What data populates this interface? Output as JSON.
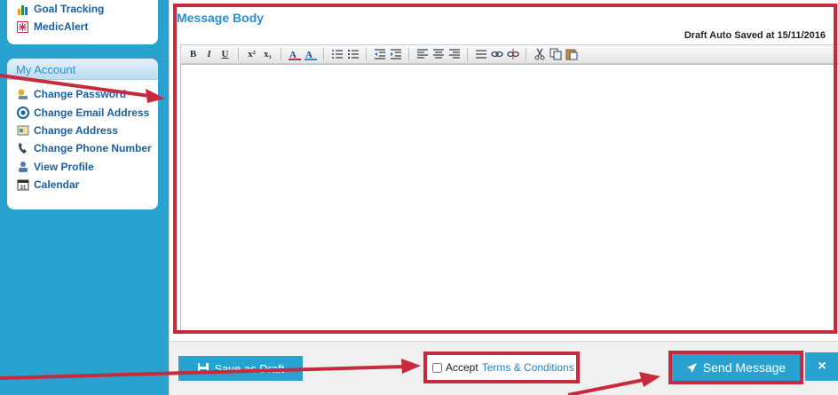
{
  "sidebar": {
    "top_items": [
      {
        "label": "Goal Tracking",
        "icon": "bar-chart-icon"
      },
      {
        "label": "MedicAlert",
        "icon": "medic-alert-icon"
      }
    ],
    "account": {
      "heading": "My Account",
      "items": [
        {
          "label": "Change Password",
          "icon": "password-icon"
        },
        {
          "label": "Change Email Address",
          "icon": "email-icon"
        },
        {
          "label": "Change Address",
          "icon": "address-icon"
        },
        {
          "label": "Change Phone Number",
          "icon": "phone-icon"
        },
        {
          "label": "View Profile",
          "icon": "profile-icon"
        },
        {
          "label": "Calendar",
          "icon": "calendar-icon"
        }
      ]
    }
  },
  "message": {
    "title": "Message Body",
    "draft_status": "Draft Auto Saved at 15/11/2016",
    "body_value": "",
    "toolbar": [
      "B",
      "I",
      "U",
      "x²",
      "x₁"
    ]
  },
  "footer": {
    "save_draft_label": "Save as Draft",
    "accept_label": "Accept",
    "terms_link": "Terms & Conditions",
    "send_label": "Send Message",
    "close_symbol": "×"
  },
  "colors": {
    "page_bg": "#2aa2cf",
    "highlight": "#c62a3c",
    "link": "#2a7fc0"
  }
}
